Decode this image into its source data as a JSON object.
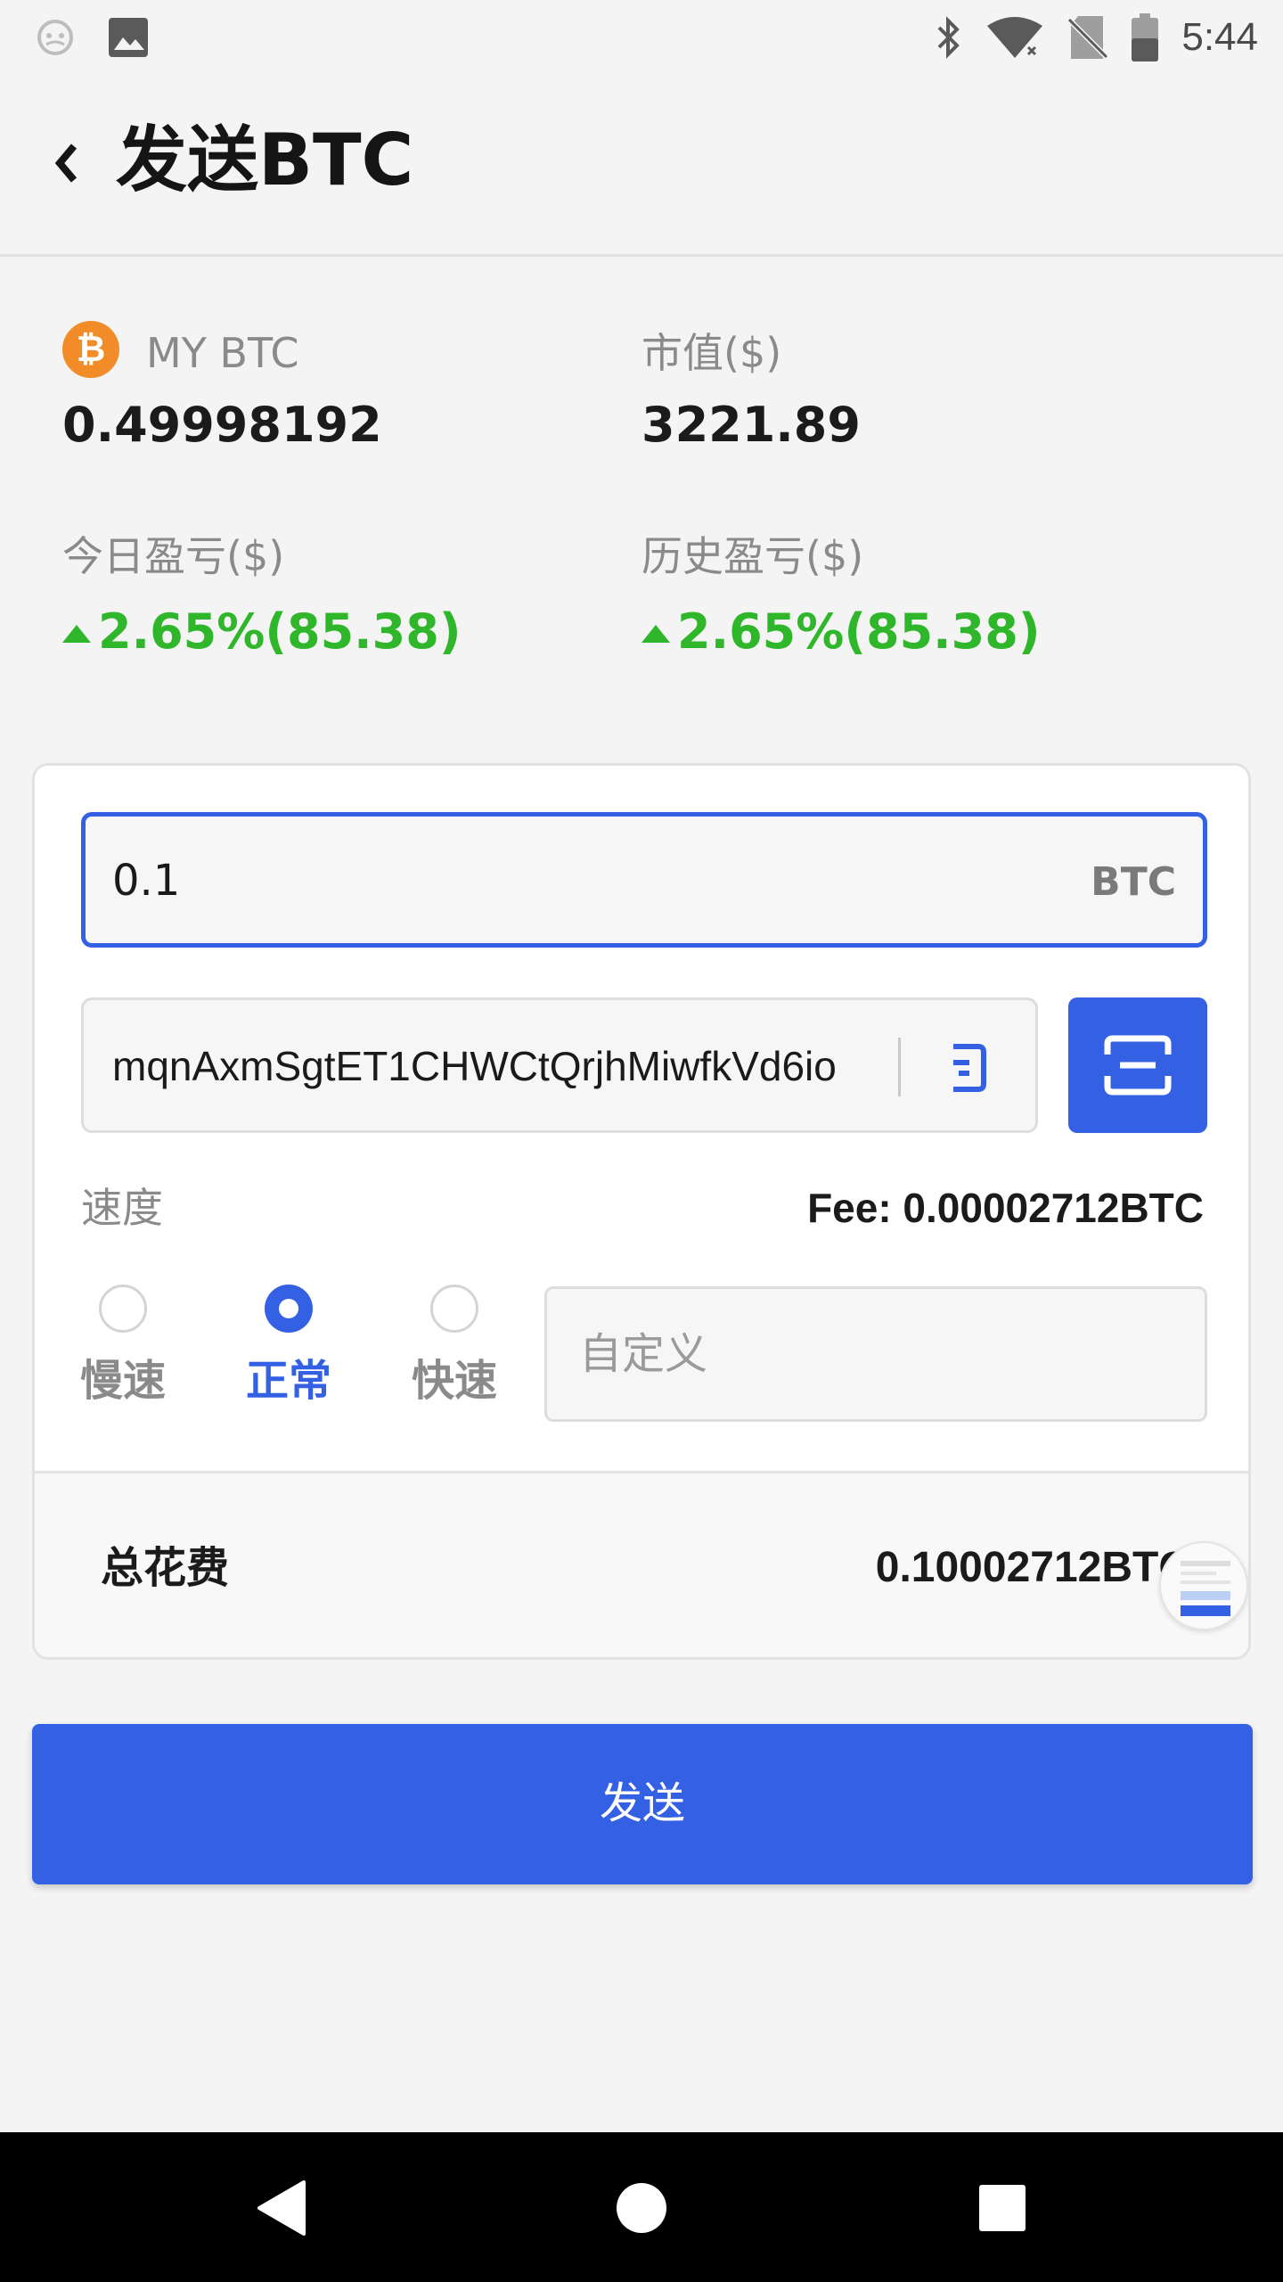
{
  "status_bar": {
    "time": "5:44",
    "icons": [
      "ghost-icon",
      "image-icon",
      "bluetooth-icon",
      "wifi-icon",
      "no-sim-icon",
      "battery-icon"
    ]
  },
  "header": {
    "title": "发送BTC"
  },
  "stats": {
    "my_btc_label": "MY BTC",
    "my_btc_value": "0.49998192",
    "market_value_label": "市值($)",
    "market_value": "3221.89",
    "today_pnl_label": "今日盈亏($)",
    "today_pnl_value": "2.65%(85.38)",
    "history_pnl_label": "历史盈亏($)",
    "history_pnl_value": "2.65%(85.38)"
  },
  "form": {
    "amount_value": "0.1",
    "amount_unit": "BTC",
    "address_value": "mqnAxmSgtET1CHWCtQrjhMiwfkVd6io",
    "speed_label": "速度",
    "fee_text": "Fee: 0.00002712BTC",
    "speed_options": [
      {
        "label": "慢速",
        "selected": false
      },
      {
        "label": "正常",
        "selected": true
      },
      {
        "label": "快速",
        "selected": false
      }
    ],
    "custom_placeholder": "自定义",
    "total_label": "总花费",
    "total_value": "0.10002712BTC"
  },
  "send_button": "发送",
  "colors": {
    "accent": "#3461e3",
    "positive": "#2fb62a",
    "btc_orange": "#f28c28",
    "background": "#f4f4f5"
  }
}
